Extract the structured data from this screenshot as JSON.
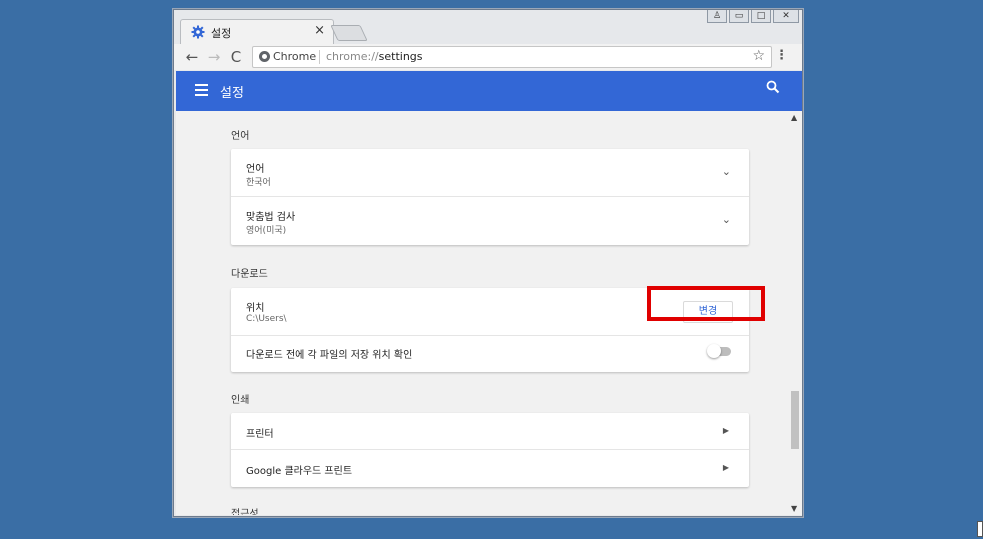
{
  "tab": {
    "title": "설정",
    "close": "×"
  },
  "window_controls": {
    "user": "♙",
    "minimize": "▭",
    "maximize": "□",
    "close": "✕"
  },
  "toolbar": {
    "back": "←",
    "forward": "→",
    "reload": "C",
    "omnibox_label": "Chrome",
    "url_scheme": "chrome://",
    "url_path": "settings",
    "star": "☆",
    "menu": "⋮"
  },
  "header": {
    "title": "설정"
  },
  "sections": {
    "language": {
      "title": "언어",
      "rows": [
        {
          "label": "언어",
          "value": "한국어"
        },
        {
          "label": "맞춤법 검사",
          "value": "영어(미국)"
        }
      ]
    },
    "downloads": {
      "title": "다운로드",
      "location_label": "위치",
      "location_value": "C:\\Users\\",
      "change_button": "변경",
      "ask_label": "다운로드 전에 각 파일의 저장 위치 확인",
      "ask_enabled": false
    },
    "printing": {
      "title": "인쇄",
      "rows": [
        {
          "label": "프린터"
        },
        {
          "label": "Google 클라우드 프린트"
        }
      ]
    },
    "accessibility": {
      "title": "접근성"
    }
  },
  "colors": {
    "header": "#3367d6",
    "highlight": "#e00000",
    "desktop": "#3a6ea5"
  },
  "icons": [
    "settings-gear-icon",
    "menu-hamburger-icon",
    "search-icon",
    "chevron-down-icon",
    "arrow-right-icon",
    "star-icon"
  ]
}
